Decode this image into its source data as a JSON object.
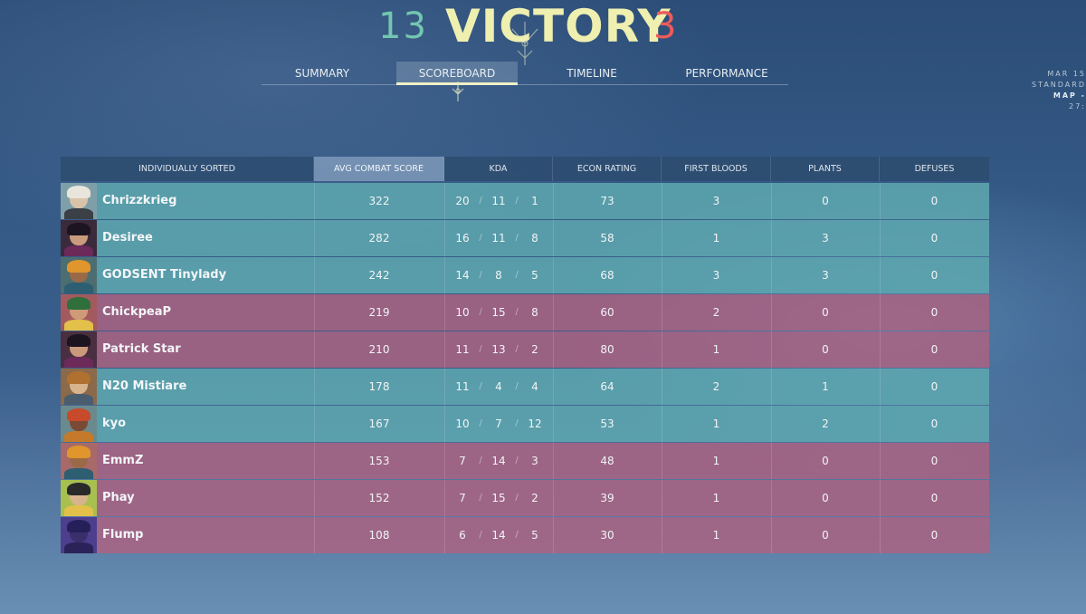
{
  "header": {
    "ally_score": "13",
    "result": "VICTORY",
    "enemy_score": "3"
  },
  "tabs": [
    {
      "label": "SUMMARY",
      "active": false
    },
    {
      "label": "SCOREBOARD",
      "active": true
    },
    {
      "label": "TIMELINE",
      "active": false
    },
    {
      "label": "PERFORMANCE",
      "active": false
    }
  ],
  "side_info": {
    "date": "MAR 15",
    "mode": "STANDARD",
    "map": "MAP -",
    "time": "27:"
  },
  "table": {
    "columns": [
      "INDIVIDUALLY SORTED",
      "AVG COMBAT SCORE",
      "KDA",
      "ECON RATING",
      "FIRST BLOODS",
      "PLANTS",
      "DEFUSES"
    ],
    "active_column": "AVG COMBAT SCORE",
    "colors": {
      "ally": "#5ea8af",
      "enemy": "#af6280",
      "accent": "#efefb0"
    },
    "rows": [
      {
        "name": "Chrizzkrieg",
        "team": "ally",
        "acs": "322",
        "k": "20",
        "d": "11",
        "a": "1",
        "econ": "73",
        "fb": "3",
        "plants": "0",
        "defuses": "0"
      },
      {
        "name": "Desiree",
        "team": "ally",
        "acs": "282",
        "k": "16",
        "d": "11",
        "a": "8",
        "econ": "58",
        "fb": "1",
        "plants": "3",
        "defuses": "0"
      },
      {
        "name": "GODSENT Tinylady",
        "team": "ally",
        "acs": "242",
        "k": "14",
        "d": "8",
        "a": "5",
        "econ": "68",
        "fb": "3",
        "plants": "3",
        "defuses": "0"
      },
      {
        "name": "ChickpeaP",
        "team": "enemy",
        "acs": "219",
        "k": "10",
        "d": "15",
        "a": "8",
        "econ": "60",
        "fb": "2",
        "plants": "0",
        "defuses": "0"
      },
      {
        "name": "Patrick Star",
        "team": "enemy",
        "acs": "210",
        "k": "11",
        "d": "13",
        "a": "2",
        "econ": "80",
        "fb": "1",
        "plants": "0",
        "defuses": "0"
      },
      {
        "name": "N20 Mistiare",
        "team": "ally",
        "acs": "178",
        "k": "11",
        "d": "4",
        "a": "4",
        "econ": "64",
        "fb": "2",
        "plants": "1",
        "defuses": "0"
      },
      {
        "name": "kyo",
        "team": "ally",
        "acs": "167",
        "k": "10",
        "d": "7",
        "a": "12",
        "econ": "53",
        "fb": "1",
        "plants": "2",
        "defuses": "0"
      },
      {
        "name": "EmmZ",
        "team": "enemy",
        "acs": "153",
        "k": "7",
        "d": "14",
        "a": "3",
        "econ": "48",
        "fb": "1",
        "plants": "0",
        "defuses": "0"
      },
      {
        "name": "Phay",
        "team": "enemy",
        "acs": "152",
        "k": "7",
        "d": "15",
        "a": "2",
        "econ": "39",
        "fb": "1",
        "plants": "0",
        "defuses": "0"
      },
      {
        "name": "Flump",
        "team": "enemy",
        "acs": "108",
        "k": "6",
        "d": "14",
        "a": "5",
        "econ": "30",
        "fb": "1",
        "plants": "0",
        "defuses": "0"
      }
    ]
  },
  "avatars": [
    {
      "icon": "agent-cypher-portrait-icon",
      "bg": "#7f9fa8",
      "skin": "#d9c3a8",
      "hair": "#e8e6dc",
      "body": "#3a4046"
    },
    {
      "icon": "agent-reyna-portrait-icon",
      "bg": "#3a2a3c",
      "skin": "#c99a7c",
      "hair": "#1c1420",
      "body": "#6b2a5a"
    },
    {
      "icon": "agent-raze-portrait-icon",
      "bg": "#4d6e70",
      "skin": "#9a6a48",
      "hair": "#e0962c",
      "body": "#2d5e72"
    },
    {
      "icon": "agent-killjoy-portrait-icon",
      "bg": "#a35a5e",
      "skin": "#cf9a78",
      "hair": "#2f6f3c",
      "body": "#e2c04a"
    },
    {
      "icon": "agent-reyna-portrait-icon",
      "bg": "#4a2f40",
      "skin": "#c99a7c",
      "hair": "#1c1420",
      "body": "#6b2a5a"
    },
    {
      "icon": "agent-sova-portrait-icon",
      "bg": "#8a6a4a",
      "skin": "#d8b48e",
      "hair": "#b07030",
      "body": "#4a5d6e"
    },
    {
      "icon": "agent-phoenix-portrait-icon",
      "bg": "#6a8a8e",
      "skin": "#7a4a34",
      "hair": "#c74a2a",
      "body": "#c47a2a"
    },
    {
      "icon": "agent-raze-portrait-icon",
      "bg": "#a86a68",
      "skin": "#9a6a48",
      "hair": "#e0962c",
      "body": "#2d5e72"
    },
    {
      "icon": "agent-killjoy-portrait-icon",
      "bg": "#a8c050",
      "skin": "#d8b48e",
      "hair": "#2a2a2a",
      "body": "#e2c04a"
    },
    {
      "icon": "agent-omen-portrait-icon",
      "bg": "#4e3e8e",
      "skin": "#3a2f6a",
      "hair": "#25205a",
      "body": "#2a2258"
    }
  ]
}
